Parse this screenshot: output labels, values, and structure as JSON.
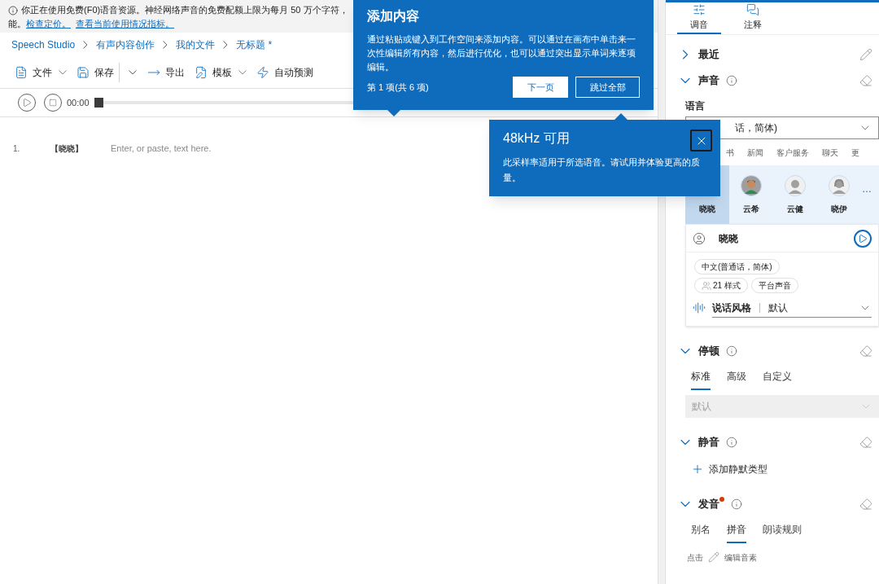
{
  "banner": {
    "text": "你正在使用免费(F0)语音资源。神经网络声音的免费配额上限为每月 50 万个字符，",
    "text_2": "能。",
    "links": [
      "检查定价。",
      "查看当前使用情况指标。"
    ]
  },
  "breadcrumb": [
    "Speech Studio",
    "有声内容创作",
    "我的文件",
    "无标题 *"
  ],
  "toolbar": [
    {
      "kind": "file",
      "label": "文件",
      "dropdown": true
    },
    {
      "kind": "save",
      "label": "保存",
      "dropdown": false
    },
    {
      "kind": "split",
      "dropdown": true
    },
    {
      "kind": "export",
      "label": "导出",
      "dropdown": false
    },
    {
      "kind": "template",
      "label": "模板",
      "dropdown": true
    },
    {
      "kind": "auto",
      "label": "自动预测",
      "dropdown": false
    }
  ],
  "player": {
    "time": "00:00",
    "level": 0
  },
  "editor": {
    "lines": [
      {
        "number": "1.",
        "voice": "【晓晓】",
        "placeholder": "Enter, or paste, text here."
      }
    ]
  },
  "coachmark": {
    "title": "添加内容",
    "body": "通过粘贴或键入到工作空间来添加内容。可以通过在画布中单击来一次性编辑所有内容，然后进行优化，也可以通过突出显示单词来逐项编辑。",
    "step": "第 1 项(共 6 项)",
    "next": "下一页",
    "skip": "跳过全部"
  },
  "callout": {
    "title": "48kHz 可用",
    "body": "此采样率适用于所选语音。请试用并体验更高的质量。"
  },
  "panel": {
    "tabs": [
      {
        "label": "调音",
        "kind": "tune",
        "selected": true
      },
      {
        "label": "注释",
        "kind": "comment",
        "selected": false
      }
    ],
    "recent": {
      "label": "最近",
      "expanded": false
    },
    "voice": {
      "label": "声音",
      "expanded": true,
      "language_label": "语言",
      "language_value": "话，简体)",
      "categories": [
        "书",
        "新闻",
        "客户服务",
        "聊天",
        "更"
      ],
      "voices": [
        {
          "name": "晓晓",
          "kind": "hidden",
          "selected": true
        },
        {
          "name": "云希",
          "kind": "boy",
          "selected": false
        },
        {
          "name": "云健",
          "kind": "man",
          "selected": false
        },
        {
          "name": "晓伊",
          "kind": "woman",
          "selected": false
        }
      ],
      "more": "…",
      "selected_name": "晓晓",
      "tags": [
        "中文(普通话，简体)",
        "21 样式",
        "平台声音"
      ],
      "style_label": "说话风格",
      "style_value": "默认"
    },
    "pause": {
      "label": "停顿",
      "expanded": true,
      "tabs": [
        {
          "label": "标准",
          "selected": true
        },
        {
          "label": "高级",
          "selected": false
        },
        {
          "label": "自定义",
          "selected": false
        }
      ],
      "value": "默认"
    },
    "silence": {
      "label": "静音",
      "expanded": true,
      "add": "添加静默类型"
    },
    "pronunciation": {
      "label": "发音",
      "expanded": true,
      "alert": true,
      "tabs": [
        {
          "label": "别名",
          "selected": false
        },
        {
          "label": "拼音",
          "selected": true
        },
        {
          "label": "朗读规则",
          "selected": false
        }
      ],
      "hint": "点击",
      "edit": "编辑音素"
    }
  }
}
